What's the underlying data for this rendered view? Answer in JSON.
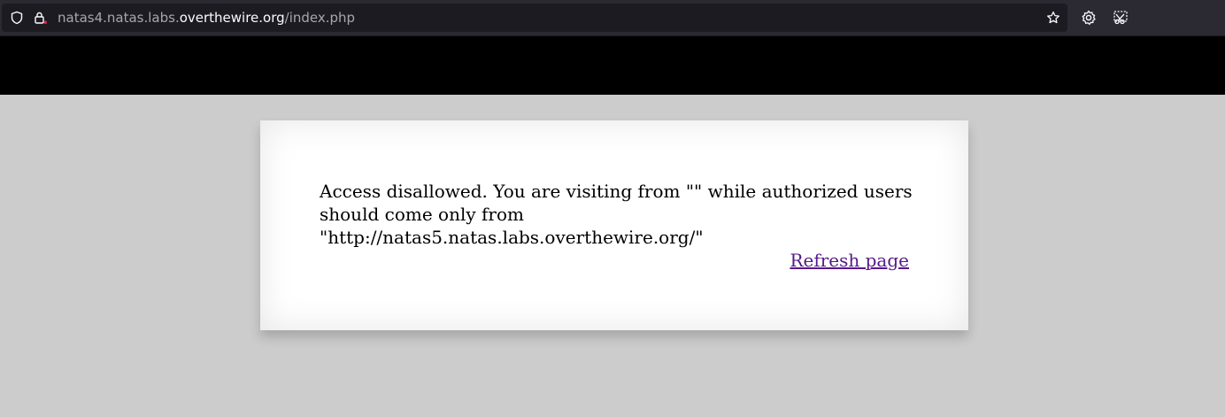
{
  "browser": {
    "url": {
      "prefix": "natas4.natas.labs.",
      "domain": "overthewire.org",
      "path": "/index.php"
    },
    "icons": {
      "tracking_protection": "shield-icon",
      "site_info": "lock-warning-icon",
      "bookmark": "star-icon",
      "settings": "gear-icon",
      "extension": "screenshot-icon"
    }
  },
  "page": {
    "message": "Access disallowed. You are visiting from \"\" while authorized users should come only from \"http://natas5.natas.labs.overthewire.org/\"",
    "refresh_label": "Refresh page",
    "colors": {
      "background": "#cccccc",
      "band": "#000000",
      "panel": "#ffffff",
      "link_visited": "#551a8b"
    }
  }
}
